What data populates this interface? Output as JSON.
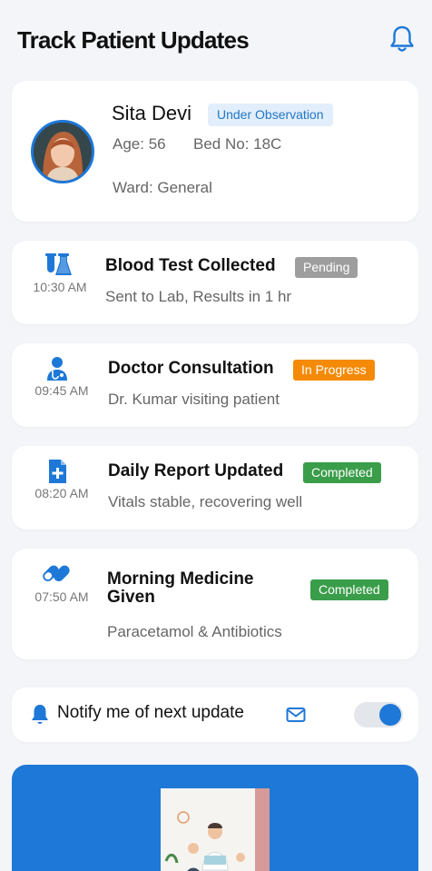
{
  "header": {
    "title": "Track Patient Updates",
    "bell_icon": "bell-icon"
  },
  "patient": {
    "name": "Sita Devi",
    "status": "Under Observation",
    "age": "Age: 56",
    "bed": "Bed No: 18C",
    "ward": "Ward: General",
    "avatar_icon": "patient-avatar"
  },
  "events": [
    {
      "icon": "lab-flask-icon",
      "time": "10:30 AM",
      "title": "Blood Test Collected",
      "badge": "Pending",
      "desc": "Sent to Lab, Results in 1 hr"
    },
    {
      "icon": "doctor-icon",
      "time": "09:45 AM",
      "title": "Doctor Consultation",
      "badge": "In Progress",
      "desc": "Dr. Kumar visiting patient"
    },
    {
      "icon": "medical-file-icon",
      "time": "08:20 AM",
      "title": "Daily Report Updated",
      "badge": "Completed",
      "desc": "Vitals stable, recovering well"
    },
    {
      "icon": "pills-icon",
      "time": "07:50 AM",
      "title": "Morning Medicine Given",
      "badge": "Completed",
      "desc": "Paracetamol & Antibiotics"
    }
  ],
  "notify": {
    "label": "Notify me of next update",
    "bell_icon": "bell-icon",
    "mail_icon": "mail-icon",
    "toggle_on": true
  },
  "colors": {
    "accent": "#1e78d7",
    "pending": "#9e9e9e",
    "in_progress": "#f58a07",
    "completed": "#3a9d4a",
    "badge_bg": "#e2eefb"
  }
}
